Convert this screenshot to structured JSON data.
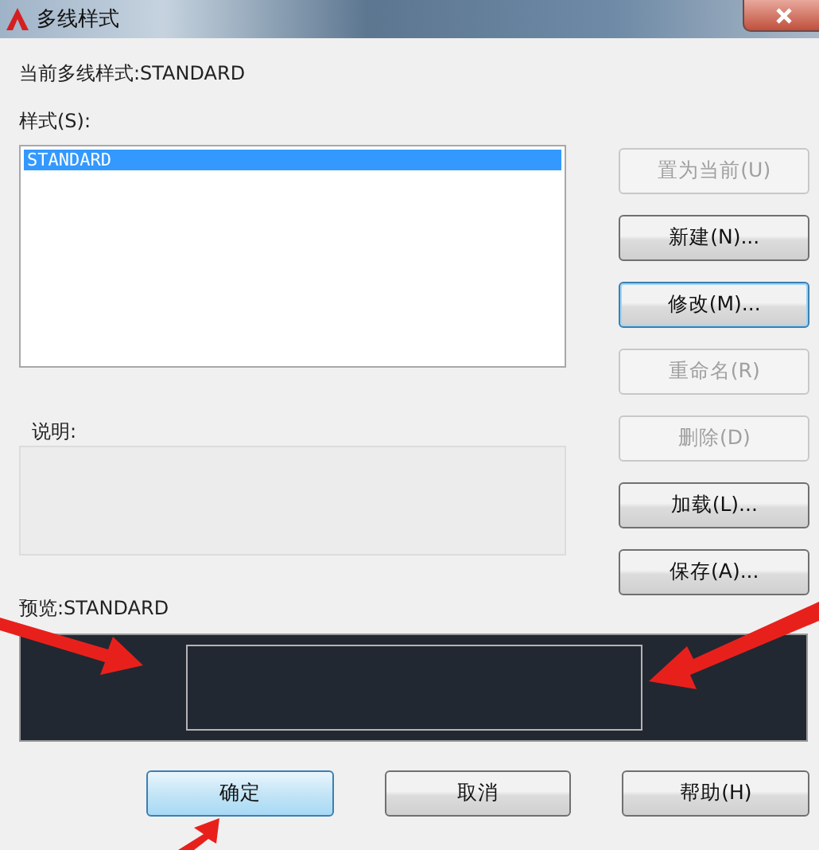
{
  "window": {
    "title": "多线样式"
  },
  "current_style": "当前多线样式:STANDARD",
  "styles": {
    "label": "样式(S):",
    "items": [
      {
        "name": "STANDARD",
        "selected": true
      }
    ]
  },
  "side_buttons": [
    {
      "label": "置为当前(U)",
      "disabled": true,
      "focused": false
    },
    {
      "label": "新建(N)...",
      "disabled": false,
      "focused": false
    },
    {
      "label": "修改(M)...",
      "disabled": false,
      "focused": true
    },
    {
      "label": "重命名(R)",
      "disabled": true,
      "focused": false
    },
    {
      "label": "删除(D)",
      "disabled": true,
      "focused": false
    },
    {
      "label": "加载(L)...",
      "disabled": false,
      "focused": false
    },
    {
      "label": "保存(A)...",
      "disabled": false,
      "focused": false
    }
  ],
  "description": {
    "label": "说明:"
  },
  "preview": {
    "label": "预览:STANDARD"
  },
  "bottom_buttons": [
    {
      "label": "确定",
      "default": true
    },
    {
      "label": "取消",
      "default": false
    },
    {
      "label": "帮助(H)",
      "default": false
    }
  ]
}
